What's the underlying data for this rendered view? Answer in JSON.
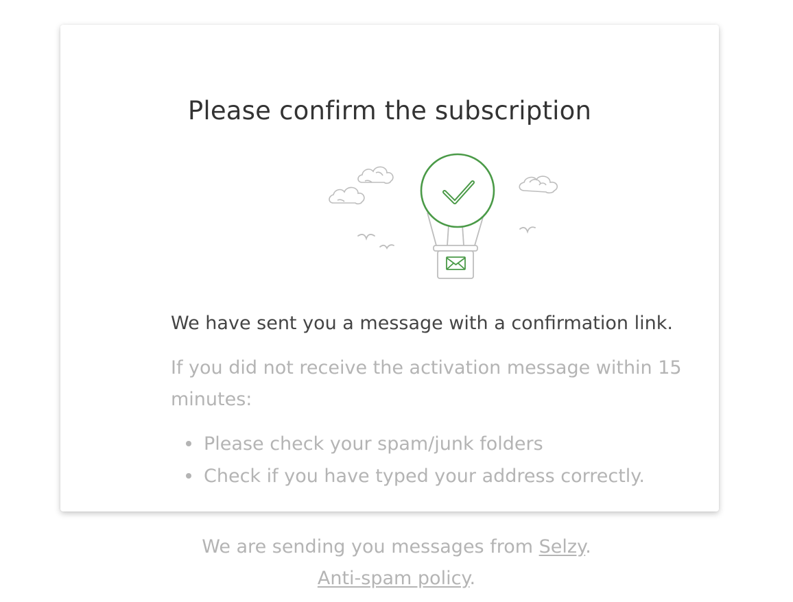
{
  "page": {
    "title": "Please confirm the subscription",
    "sent_message": "We have sent you a message with a confirmation link.",
    "hint": "If you did not receive the activation message within 15 minutes:",
    "tips": [
      "Please check your spam/junk folders",
      "Check if you have typed your address correctly."
    ]
  },
  "footer": {
    "prefix": "We are sending you messages from ",
    "brand_link": "Selzy",
    "suffix": ".",
    "policy_link": "Anti-spam policy",
    "policy_suffix": "."
  },
  "illustration": {
    "icon": "hot-air-balloon-icon",
    "accent_color": "#4a9a47",
    "line_color": "#bdbdbd"
  }
}
